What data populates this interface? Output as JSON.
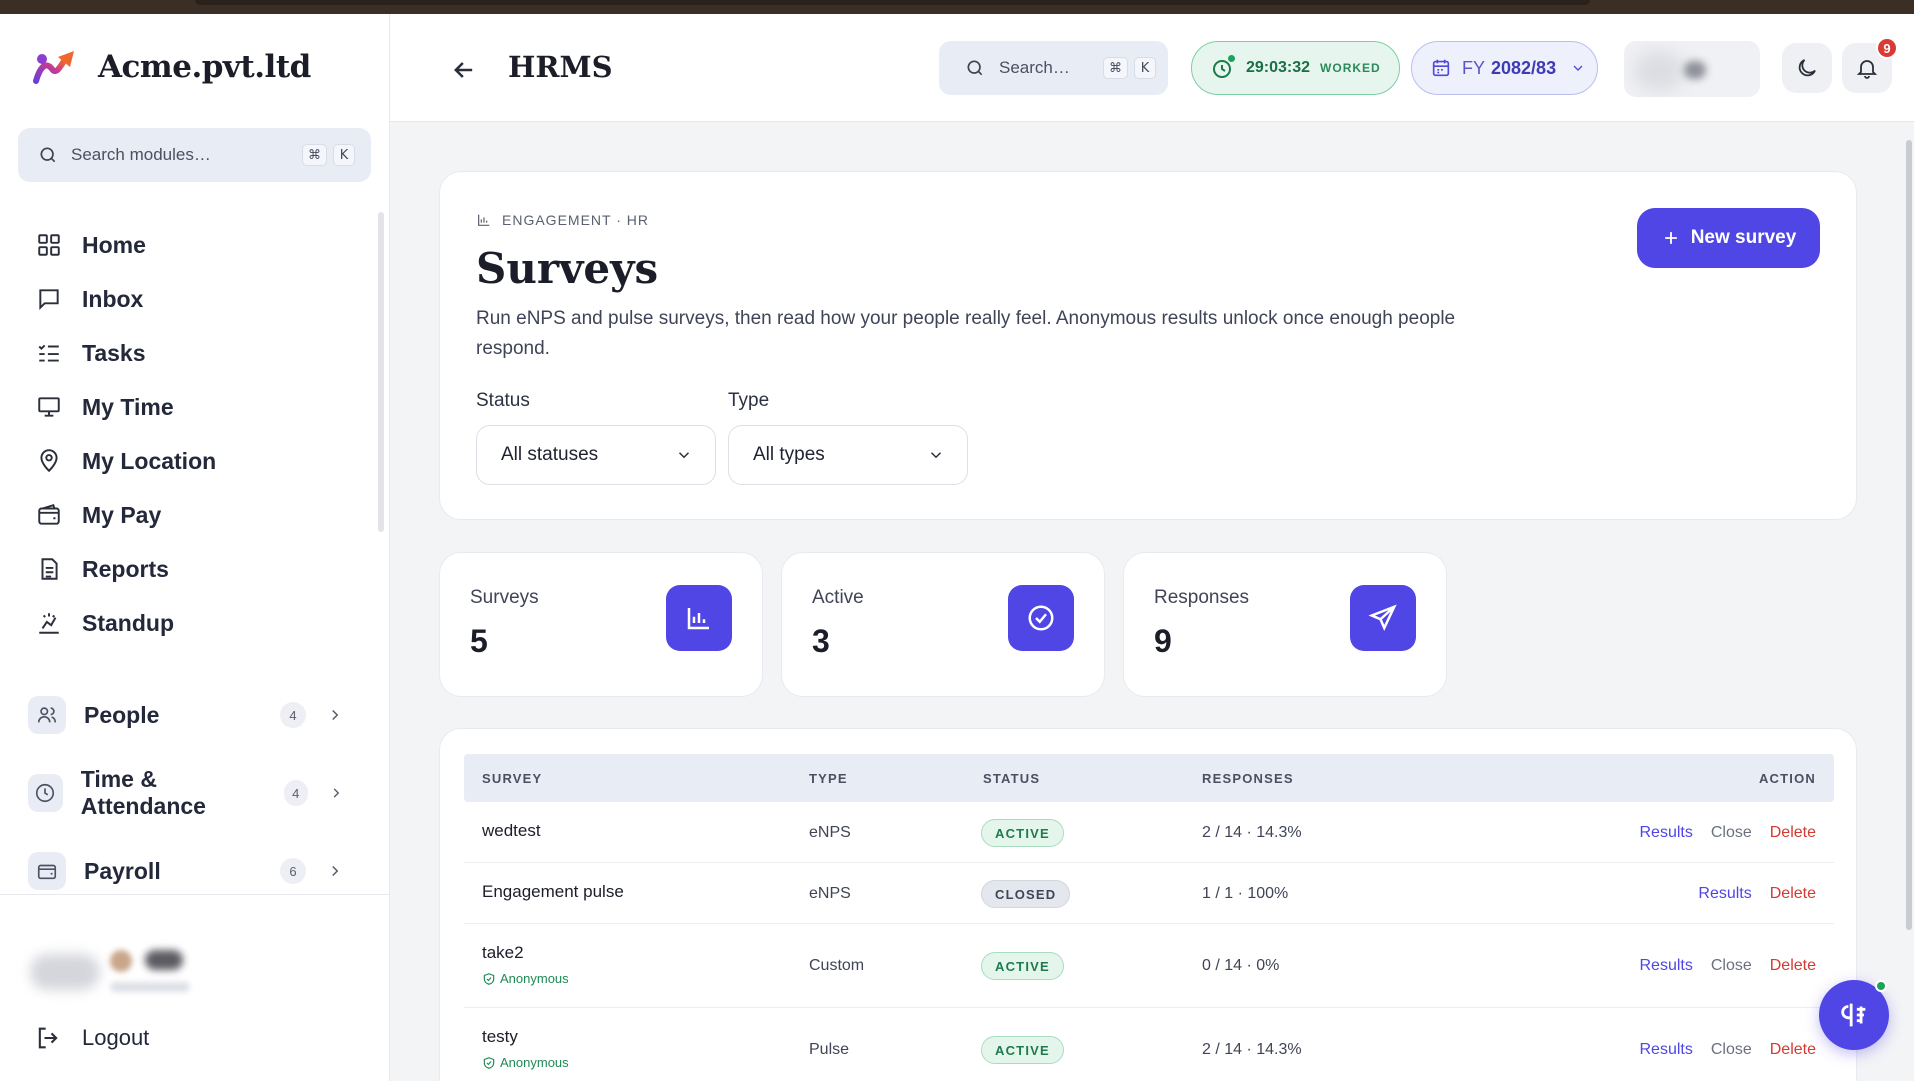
{
  "app": {
    "name": "Acme.pvt.ltd"
  },
  "sidebar": {
    "search_placeholder": "Search modules…",
    "shortcut": [
      "⌘",
      "K"
    ],
    "items": [
      {
        "label": "Home",
        "icon": "grid-icon"
      },
      {
        "label": "Inbox",
        "icon": "message-icon"
      },
      {
        "label": "Tasks",
        "icon": "list-check-icon"
      },
      {
        "label": "My Time",
        "icon": "monitor-icon"
      },
      {
        "label": "My Location",
        "icon": "map-pin-icon"
      },
      {
        "label": "My Pay",
        "icon": "wallet-icon"
      },
      {
        "label": "Reports",
        "icon": "file-text-icon"
      },
      {
        "label": "Standup",
        "icon": "standup-icon"
      }
    ],
    "groups": [
      {
        "label": "People",
        "count": "4",
        "icon": "users-icon"
      },
      {
        "label": "Time & Attendance",
        "count": "4",
        "icon": "clock-icon"
      },
      {
        "label": "Payroll",
        "count": "6",
        "icon": "wallet-icon"
      }
    ],
    "logout_label": "Logout"
  },
  "header": {
    "title": "HRMS",
    "search_placeholder": "Search…",
    "shortcut": [
      "⌘",
      "K"
    ],
    "worked_time": "29:03:32",
    "worked_label": "WORKED",
    "fy_prefix": "FY",
    "fy_value": "2082/83",
    "notification_count": "9"
  },
  "page": {
    "eyebrow": "ENGAGEMENT · HR",
    "title": "Surveys",
    "description": "Run eNPS and pulse surveys, then read how your people really feel. Anonymous results unlock once enough people respond.",
    "new_button": "New survey",
    "filters": {
      "status_label": "Status",
      "status_value": "All statuses",
      "type_label": "Type",
      "type_value": "All types"
    }
  },
  "stats": [
    {
      "label": "Surveys",
      "value": "5",
      "icon": "bar-chart-icon"
    },
    {
      "label": "Active",
      "value": "3",
      "icon": "check-circle-icon"
    },
    {
      "label": "Responses",
      "value": "9",
      "icon": "send-icon"
    }
  ],
  "table": {
    "headers": {
      "survey": "SURVEY",
      "type": "TYPE",
      "status": "STATUS",
      "responses": "RESPONSES",
      "action": "ACTION"
    },
    "anonymous_label": "Anonymous",
    "actions": {
      "results": "Results",
      "close": "Close",
      "delete": "Delete"
    },
    "rows": [
      {
        "name": "wedtest",
        "type": "eNPS",
        "status": "ACTIVE",
        "responses": "2 / 14 · 14.3%"
      },
      {
        "name": "Engagement pulse",
        "type": "eNPS",
        "status": "CLOSED",
        "responses": "1 / 1 · 100%"
      },
      {
        "name": "take2",
        "type": "Custom",
        "status": "ACTIVE",
        "responses": "0 / 14 · 0%"
      },
      {
        "name": "testy",
        "type": "Pulse",
        "status": "ACTIVE",
        "responses": "2 / 14 · 14.3%"
      }
    ]
  },
  "colors": {
    "accent": "#4f46e5",
    "success": "#1f7a4d",
    "danger": "#d23a32"
  }
}
